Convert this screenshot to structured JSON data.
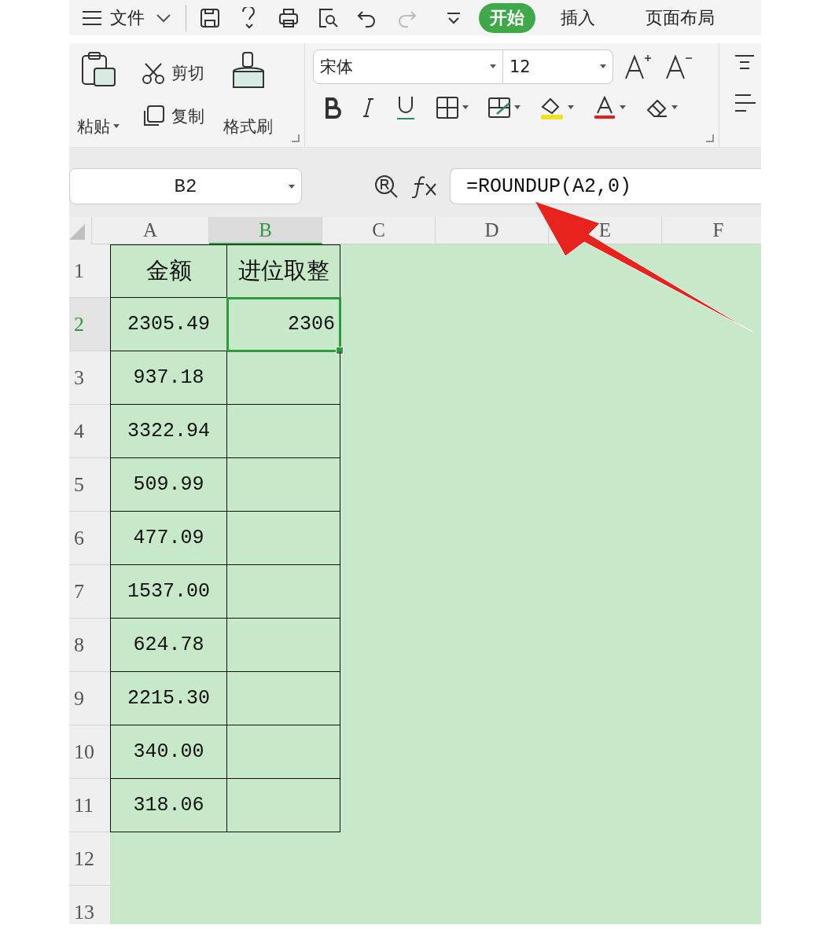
{
  "menu_bar": {
    "menu_label": "文件",
    "tabs": [
      {
        "label": "开始",
        "selected": true
      },
      {
        "label": "插入",
        "selected": false
      },
      {
        "label": "页面布局",
        "selected": false
      }
    ]
  },
  "ribbon": {
    "paste": "粘贴",
    "cut": "剪切",
    "copy": "复制",
    "format_painter": "格式刷",
    "font_name": "宋体",
    "font_size": "12"
  },
  "formula_bar": {
    "name_box": "B2",
    "formula": "=ROUNDUP(A2,0)"
  },
  "sheet": {
    "columns": [
      {
        "label": "A",
        "selected": false
      },
      {
        "label": "B",
        "selected": true
      },
      {
        "label": "C",
        "selected": false
      },
      {
        "label": "D",
        "selected": false
      },
      {
        "label": "E",
        "selected": false
      },
      {
        "label": "F",
        "selected": false
      }
    ],
    "rows": [
      {
        "label": "1",
        "selected": false,
        "cells": [
          {
            "value": "金额",
            "selected": false
          },
          {
            "value": "进位取整",
            "selected": false
          }
        ]
      },
      {
        "label": "2",
        "selected": true,
        "cells": [
          {
            "value": "2305.49",
            "selected": false
          },
          {
            "value": "2306",
            "selected": true
          }
        ]
      },
      {
        "label": "3",
        "selected": false,
        "cells": [
          {
            "value": "937.18",
            "selected": false
          },
          {
            "selected": false
          }
        ]
      },
      {
        "label": "4",
        "selected": false,
        "cells": [
          {
            "value": "3322.94",
            "selected": false
          },
          {
            "selected": false
          }
        ]
      },
      {
        "label": "5",
        "selected": false,
        "cells": [
          {
            "value": "509.99",
            "selected": false
          },
          {
            "selected": false
          }
        ]
      },
      {
        "label": "6",
        "selected": false,
        "cells": [
          {
            "value": "477.09",
            "selected": false
          },
          {
            "selected": false
          }
        ]
      },
      {
        "label": "7",
        "selected": false,
        "cells": [
          {
            "value": "1537.00",
            "selected": false
          },
          {
            "selected": false
          }
        ]
      },
      {
        "label": "8",
        "selected": false,
        "cells": [
          {
            "value": "624.78",
            "selected": false
          },
          {
            "selected": false
          }
        ]
      },
      {
        "label": "9",
        "selected": false,
        "cells": [
          {
            "value": "2215.30",
            "selected": false
          },
          {
            "selected": false
          }
        ]
      },
      {
        "label": "10",
        "selected": false,
        "cells": [
          {
            "value": "340.00",
            "selected": false
          },
          {
            "selected": false
          }
        ]
      },
      {
        "label": "11",
        "selected": false,
        "cells": [
          {
            "value": "318.06",
            "selected": false
          },
          {
            "selected": false
          }
        ]
      },
      {
        "label": "12",
        "selected": false
      },
      {
        "label": "13",
        "selected": false
      }
    ]
  }
}
